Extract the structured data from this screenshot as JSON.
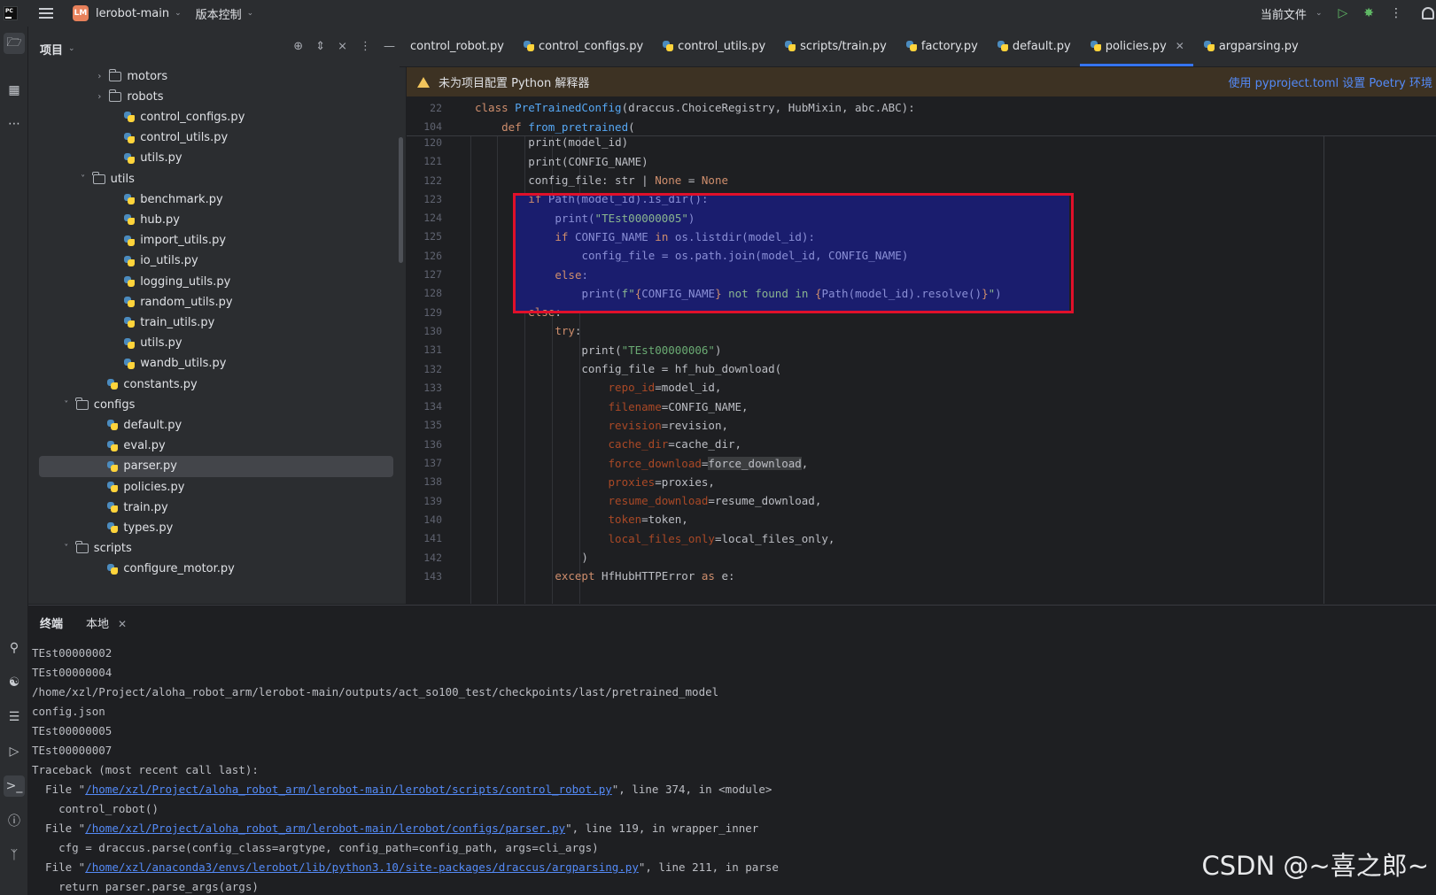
{
  "titlebar": {
    "project_badge": "LM",
    "project_name": "lerobot-main",
    "vcs": "版本控制",
    "current_file": "当前文件"
  },
  "project_panel": {
    "title": "项目",
    "tree": [
      {
        "label": "motors",
        "type": "folder",
        "expanded": false,
        "depth": 3
      },
      {
        "label": "robots",
        "type": "folder",
        "expanded": false,
        "depth": 3
      },
      {
        "label": "control_configs.py",
        "type": "file",
        "depth": 4
      },
      {
        "label": "control_utils.py",
        "type": "file",
        "depth": 4
      },
      {
        "label": "utils.py",
        "type": "file",
        "depth": 4
      },
      {
        "label": "utils",
        "type": "folder",
        "expanded": true,
        "depth": 2
      },
      {
        "label": "benchmark.py",
        "type": "file",
        "depth": 4
      },
      {
        "label": "hub.py",
        "type": "file",
        "depth": 4
      },
      {
        "label": "import_utils.py",
        "type": "file",
        "depth": 4
      },
      {
        "label": "io_utils.py",
        "type": "file",
        "depth": 4
      },
      {
        "label": "logging_utils.py",
        "type": "file",
        "depth": 4
      },
      {
        "label": "random_utils.py",
        "type": "file",
        "depth": 4
      },
      {
        "label": "train_utils.py",
        "type": "file",
        "depth": 4
      },
      {
        "label": "utils.py",
        "type": "file",
        "depth": 4
      },
      {
        "label": "wandb_utils.py",
        "type": "file",
        "depth": 4
      },
      {
        "label": "constants.py",
        "type": "file",
        "depth": 3
      },
      {
        "label": "configs",
        "type": "folder",
        "expanded": true,
        "depth": 1
      },
      {
        "label": "default.py",
        "type": "file",
        "depth": 3
      },
      {
        "label": "eval.py",
        "type": "file",
        "depth": 3
      },
      {
        "label": "parser.py",
        "type": "file",
        "depth": 3,
        "selected": true
      },
      {
        "label": "policies.py",
        "type": "file",
        "depth": 3
      },
      {
        "label": "train.py",
        "type": "file",
        "depth": 3
      },
      {
        "label": "types.py",
        "type": "file",
        "depth": 3
      },
      {
        "label": "scripts",
        "type": "folder",
        "expanded": true,
        "depth": 1
      },
      {
        "label": "configure_motor.py",
        "type": "file",
        "depth": 3
      }
    ]
  },
  "editor": {
    "tabs": [
      {
        "label": "control_robot.py",
        "active": false
      },
      {
        "label": "control_configs.py",
        "active": false
      },
      {
        "label": "control_utils.py",
        "active": false
      },
      {
        "label": "scripts/train.py",
        "active": false
      },
      {
        "label": "factory.py",
        "active": false
      },
      {
        "label": "default.py",
        "active": false
      },
      {
        "label": "policies.py",
        "active": true
      },
      {
        "label": "argparsing.py",
        "active": false
      }
    ],
    "banner_text": "未为项目配置 Python 解释器",
    "banner_link": "使用 pyproject.toml 设置 Poetry 环境",
    "sticky_lines": [
      {
        "num": "22",
        "text": "class PreTrainedConfig(draccus.ChoiceRegistry, HubMixin, abc.ABC):"
      },
      {
        "num": "104",
        "text": "    def from_pretrained("
      }
    ],
    "lines": [
      {
        "num": "120",
        "text": "        print(model_id)"
      },
      {
        "num": "121",
        "text": "        print(CONFIG_NAME)"
      },
      {
        "num": "122",
        "text": "        config_file: str | None = None"
      },
      {
        "num": "123",
        "text": "        if Path(model_id).is_dir():"
      },
      {
        "num": "124",
        "text": "            print(\"TEst00000005\")"
      },
      {
        "num": "125",
        "text": "            if CONFIG_NAME in os.listdir(model_id):"
      },
      {
        "num": "126",
        "text": "                config_file = os.path.join(model_id, CONFIG_NAME)"
      },
      {
        "num": "127",
        "text": "            else:"
      },
      {
        "num": "128",
        "text": "                print(f\"{CONFIG_NAME} not found in {Path(model_id).resolve()}\")"
      },
      {
        "num": "129",
        "text": "        else:"
      },
      {
        "num": "130",
        "text": "            try:"
      },
      {
        "num": "131",
        "text": "                print(\"TEst00000006\")"
      },
      {
        "num": "132",
        "text": "                config_file = hf_hub_download("
      },
      {
        "num": "133",
        "text": "                    repo_id=model_id,"
      },
      {
        "num": "134",
        "text": "                    filename=CONFIG_NAME,"
      },
      {
        "num": "135",
        "text": "                    revision=revision,"
      },
      {
        "num": "136",
        "text": "                    cache_dir=cache_dir,"
      },
      {
        "num": "137",
        "text": "                    force_download=force_download,"
      },
      {
        "num": "138",
        "text": "                    proxies=proxies,"
      },
      {
        "num": "139",
        "text": "                    resume_download=resume_download,"
      },
      {
        "num": "140",
        "text": "                    token=token,"
      },
      {
        "num": "141",
        "text": "                    local_files_only=local_files_only,"
      },
      {
        "num": "142",
        "text": "                )"
      },
      {
        "num": "143",
        "text": "            except HfHubHTTPError as e:"
      }
    ]
  },
  "terminal": {
    "tab_label": "终端",
    "session_label": "本地",
    "lines": [
      {
        "text": "TEst00000002"
      },
      {
        "text": "TEst00000004"
      },
      {
        "text": "/home/xzl/Project/aloha_robot_arm/lerobot-main/outputs/act_so100_test/checkpoints/last/pretrained_model"
      },
      {
        "text": "config.json"
      },
      {
        "text": "TEst00000005"
      },
      {
        "text": "TEst00000007"
      },
      {
        "text": "Traceback (most recent call last):"
      },
      {
        "pre": "  File \"",
        "link": "/home/xzl/Project/aloha_robot_arm/lerobot-main/lerobot/scripts/control_robot.py",
        "post": "\", line 374, in <module>"
      },
      {
        "text": "    control_robot()"
      },
      {
        "pre": "  File \"",
        "link": "/home/xzl/Project/aloha_robot_arm/lerobot-main/lerobot/configs/parser.py",
        "post": "\", line 119, in wrapper_inner"
      },
      {
        "text": "    cfg = draccus.parse(config_class=argtype, config_path=config_path, args=cli_args)"
      },
      {
        "pre": "  File \"",
        "link": "/home/xzl/anaconda3/envs/lerobot/lib/python3.10/site-packages/draccus/argparsing.py",
        "post": "\", line 211, in parse"
      },
      {
        "text": "    return parser.parse_args(args)"
      }
    ]
  },
  "watermark": "CSDN @~喜之郎~",
  "colors": {
    "accent": "#3574f0",
    "highlight_box": "#e0102a",
    "selection": "#1a1d6e",
    "link": "#548af7"
  }
}
